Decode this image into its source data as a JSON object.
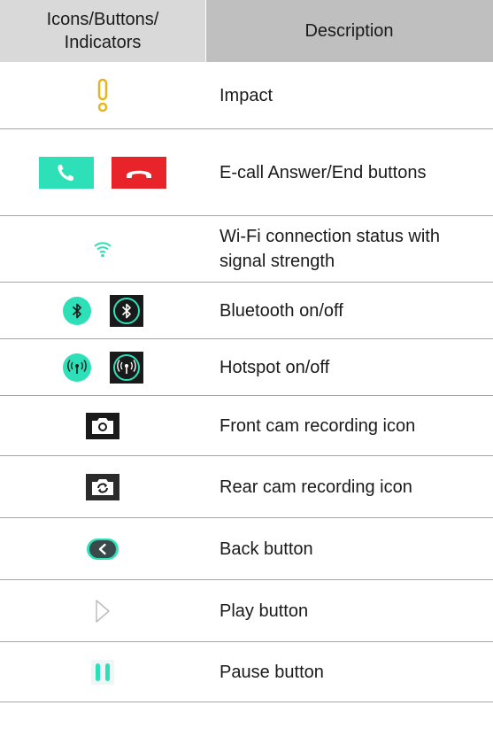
{
  "header": {
    "col1": "Icons/Buttons/\nIndicators",
    "col1_line1": "Icons/Buttons/",
    "col1_line2": "Indicators",
    "col2": "Description"
  },
  "rows": [
    {
      "icons": [
        "impact-icon"
      ],
      "description": "Impact"
    },
    {
      "icons": [
        "answer-call-button-icon",
        "end-call-button-icon"
      ],
      "description": "E-call Answer/End buttons"
    },
    {
      "icons": [
        "wifi-icon"
      ],
      "description": "Wi-Fi connection status with signal strength"
    },
    {
      "icons": [
        "bluetooth-on-icon",
        "bluetooth-off-icon"
      ],
      "description": "Bluetooth on/off"
    },
    {
      "icons": [
        "hotspot-on-icon",
        "hotspot-off-icon"
      ],
      "description": "Hotspot on/off"
    },
    {
      "icons": [
        "front-camera-icon"
      ],
      "description": "Front cam recording icon"
    },
    {
      "icons": [
        "rear-camera-icon"
      ],
      "description": "Rear cam recording icon"
    },
    {
      "icons": [
        "back-button-icon"
      ],
      "description": "Back button"
    },
    {
      "icons": [
        "play-button-icon"
      ],
      "description": "Play button"
    },
    {
      "icons": [
        "pause-button-icon"
      ],
      "description": "Pause button"
    }
  ],
  "colors": {
    "header_bg": "#d9d9d9",
    "header_desc_bg": "#bfbfbf",
    "accent_teal": "#2ee0b8",
    "end_red": "#e8242a",
    "impact_yellow": "#e8b51f"
  }
}
